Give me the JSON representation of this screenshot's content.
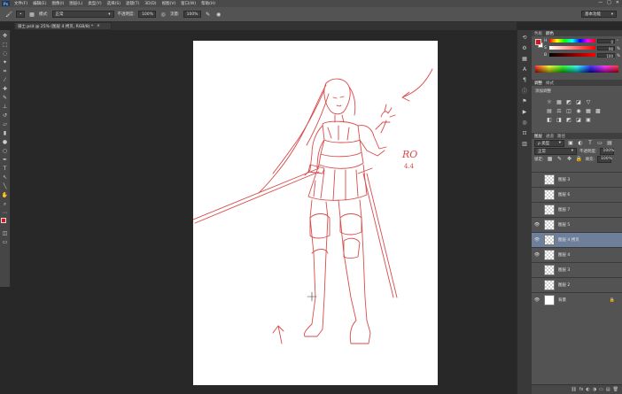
{
  "menu": {
    "logo": "Ps",
    "items": [
      "文件(F)",
      "编辑(E)",
      "图像(I)",
      "图层(L)",
      "类型(Y)",
      "选择(S)",
      "滤镜(T)",
      "3D(D)",
      "视图(V)",
      "窗口(W)",
      "帮助(H)"
    ],
    "window_controls": [
      "—",
      "□",
      "✕"
    ]
  },
  "options": {
    "mode_label": "模式:",
    "mode_value": "正常",
    "opacity_label": "不透明度:",
    "opacity_value": "100%",
    "flow_label": "流量:",
    "flow_value": "100%",
    "workspace": "基本功能"
  },
  "document": {
    "tab_title": "骑士.psd @ 25% (图层 4 拷贝, RGB/8) *",
    "close": "×"
  },
  "colors": {
    "foreground": "#e0101a",
    "background": "#ffffff"
  },
  "color_panel": {
    "tabs": [
      "色板",
      "颜色"
    ],
    "channels": [
      {
        "name": "H",
        "value": "0",
        "unit": "°",
        "gradient": "linear-gradient(to right,#ff0000,#ffff00,#00ff00,#00ffff,#0000ff,#ff00ff,#ff0000)"
      },
      {
        "name": "S",
        "value": "96",
        "unit": "%",
        "gradient": "linear-gradient(to right,#ffffff,#ff0000)"
      },
      {
        "name": "B",
        "value": "100",
        "unit": "%",
        "gradient": "linear-gradient(to right,#000000,#ff0000)"
      }
    ]
  },
  "adjustments": {
    "tabs": [
      "调整",
      "样式"
    ],
    "title": "添加调整",
    "row1": [
      "☼",
      "▦",
      "◩",
      "◪",
      "▽"
    ],
    "row2": [
      "▤",
      "⚖",
      "◫",
      "◉",
      "▦",
      "▩"
    ],
    "row3": [
      "◧",
      "◨",
      "◩",
      "◪",
      "▣"
    ]
  },
  "layers_panel": {
    "tabs": [
      "图层",
      "通道",
      "路径"
    ],
    "kind_filter": "ρ 类型",
    "blend_mode": "正常",
    "opacity_label": "不透明度:",
    "opacity_value": "100%",
    "lock_label": "锁定:",
    "fill_label": "填充:",
    "fill_value": "100%",
    "layers": [
      {
        "name": "图层 3",
        "visible": false,
        "active": false,
        "white": false
      },
      {
        "name": "图层 6",
        "visible": false,
        "active": false,
        "white": false
      },
      {
        "name": "图层 7",
        "visible": false,
        "active": false,
        "white": false
      },
      {
        "name": "图层 5",
        "visible": true,
        "active": false,
        "white": false
      },
      {
        "name": "图层 4 拷贝",
        "visible": true,
        "active": true,
        "white": false
      },
      {
        "name": "图层 4",
        "visible": true,
        "active": false,
        "white": false
      },
      {
        "name": "图层 3",
        "visible": false,
        "active": false,
        "white": false
      },
      {
        "name": "图层 2",
        "visible": false,
        "active": false,
        "white": false
      },
      {
        "name": "背景",
        "visible": true,
        "active": false,
        "white": true,
        "locked": true
      }
    ],
    "footer_icons": [
      "⛓",
      "fx",
      "◐",
      "◑",
      "▭",
      "▤",
      "🗑"
    ]
  },
  "canvas_text": {
    "signature": "RO",
    "signature_sub": "4.4"
  }
}
